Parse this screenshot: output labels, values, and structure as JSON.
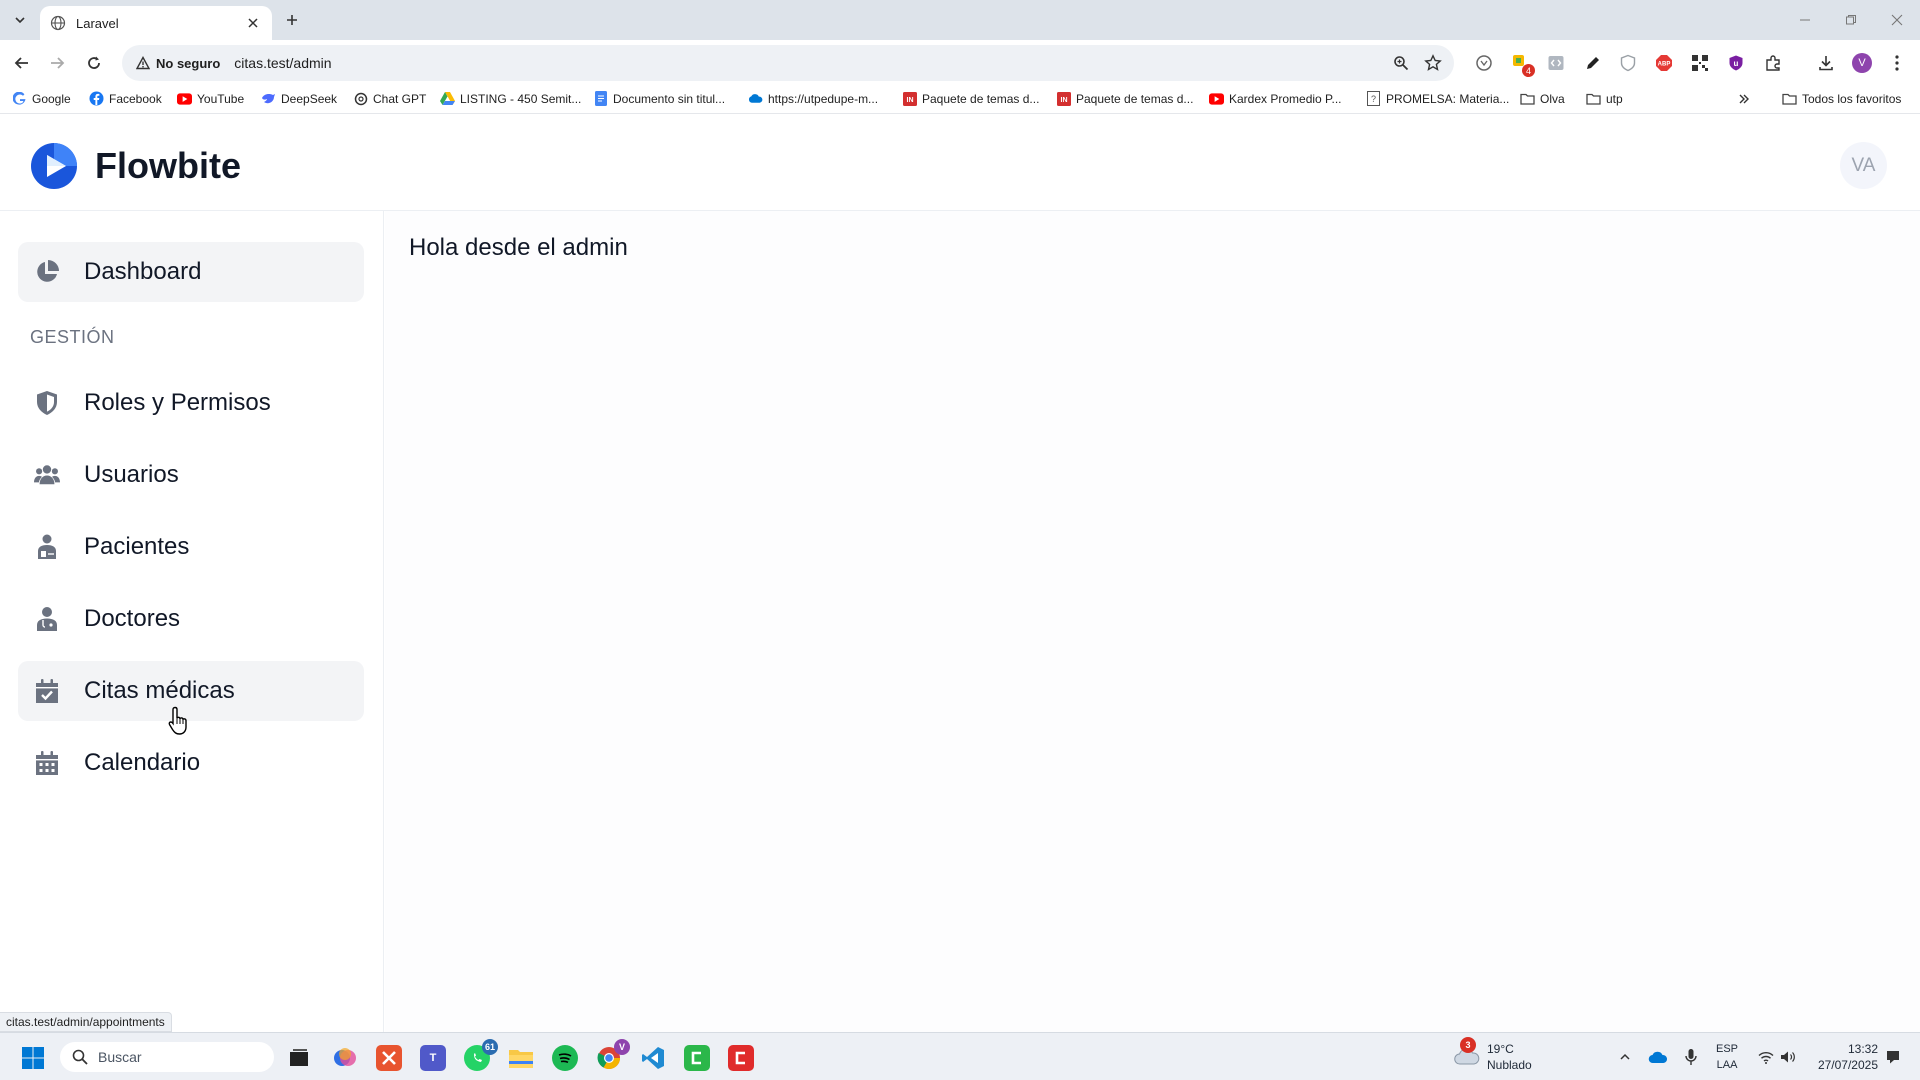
{
  "browser": {
    "tab_title": "Laravel",
    "security_label": "No seguro",
    "url": "citas.test/admin",
    "status_url": "citas.test/admin/appointments",
    "extensions": [
      "zoom-icon",
      "star-icon",
      "ext-circle-icon",
      "ext-badge-icon",
      "ext-code-icon",
      "ext-pen-icon",
      "ext-shield-icon",
      "adblock-icon",
      "qr-icon",
      "ublock-icon",
      "puzzle-icon",
      "download-icon",
      "profile-icon",
      "menu-icon"
    ],
    "profile_initial": "V",
    "ext_badge_count": "4",
    "bookmarks": [
      {
        "label": "Google",
        "icon": "google-icon",
        "color": "#4285f4"
      },
      {
        "label": "Facebook",
        "icon": "facebook-icon",
        "color": "#1877f2"
      },
      {
        "label": "YouTube",
        "icon": "youtube-icon",
        "color": "#ff0000"
      },
      {
        "label": "DeepSeek",
        "icon": "deepseek-icon",
        "color": "#4d6bfe"
      },
      {
        "label": "Chat GPT",
        "icon": "chatgpt-icon",
        "color": "#333333"
      },
      {
        "label": "LISTING - 450 Semit...",
        "icon": "drive-icon",
        "color": "#34a853"
      },
      {
        "label": "Documento sin titul...",
        "icon": "docs-icon",
        "color": "#4285f4"
      },
      {
        "label": "https://utpedupe-m...",
        "icon": "onedrive-icon",
        "color": "#0078d4"
      },
      {
        "label": "Paquete de temas d...",
        "icon": "pdf-icon",
        "color": "#d32f2f"
      },
      {
        "label": "Paquete de temas d...",
        "icon": "pdf-icon",
        "color": "#d32f2f"
      },
      {
        "label": "Kardex Promedio P...",
        "icon": "youtube-icon",
        "color": "#ff0000"
      },
      {
        "label": "PROMELSA: Materia...",
        "icon": "promelsa-icon",
        "color": "#555555"
      },
      {
        "label": "Olva",
        "icon": "folder-icon",
        "color": "#444444"
      },
      {
        "label": "utp",
        "icon": "folder-icon",
        "color": "#444444"
      }
    ],
    "all_favorites": "Todos los favoritos"
  },
  "app": {
    "brand": "Flowbite",
    "avatar_initials": "VA",
    "accent": "#1a56db",
    "sidebar": {
      "dashboard": "Dashboard",
      "section_title": "GESTIÓN",
      "items": [
        {
          "label": "Roles y Permisos",
          "icon": "shield-icon"
        },
        {
          "label": "Usuarios",
          "icon": "users-icon"
        },
        {
          "label": "Pacientes",
          "icon": "patient-icon"
        },
        {
          "label": "Doctores",
          "icon": "doctor-icon"
        },
        {
          "label": "Citas médicas",
          "icon": "calendar-check-icon"
        },
        {
          "label": "Calendario",
          "icon": "calendar-icon"
        }
      ]
    },
    "main": {
      "greeting": "Hola desde el admin"
    }
  },
  "taskbar": {
    "search_placeholder": "Buscar",
    "whatsapp_badge": "61",
    "chrome_badge": "V",
    "weather_badge": "3",
    "weather_temp": "19°C",
    "weather_desc": "Nublado",
    "lang_top": "ESP",
    "lang_bottom": "LAA",
    "time": "13:32",
    "date": "27/07/2025"
  }
}
